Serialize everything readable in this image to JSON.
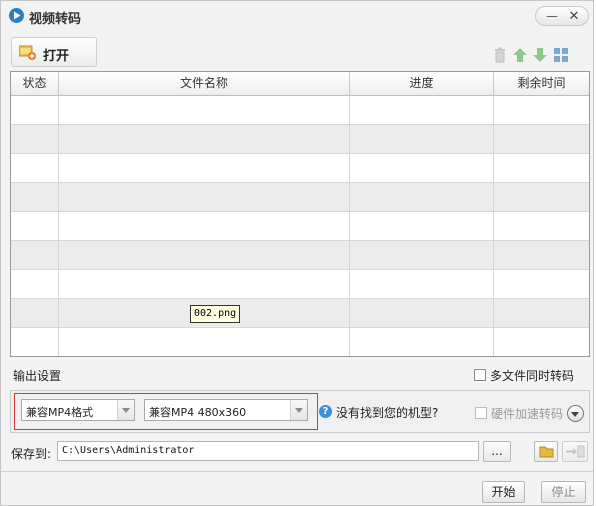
{
  "window": {
    "title": "视频转码",
    "minimize_symbol": "—",
    "close_symbol": "✕"
  },
  "toolbar": {
    "open_label": "打开",
    "icons": [
      "trash-icon",
      "move-up-icon",
      "move-down-icon",
      "grid-view-icon"
    ]
  },
  "file_table": {
    "columns": [
      "状态",
      "文件名称",
      "进度",
      "剩余时间"
    ],
    "rows": [],
    "tooltip": "002.png"
  },
  "output_settings": {
    "label": "输出设置",
    "multi_file_label": "多文件同时转码",
    "multi_file_checked": false,
    "format_select": "兼容MP4格式",
    "profile_select": "兼容MP4 480x360",
    "help_text": "没有找到您的机型?",
    "hw_accel_label": "硬件加速转码",
    "hw_accel_checked": false
  },
  "save": {
    "label": "保存到:",
    "path": "C:\\Users\\Administrator",
    "browse_label": "..."
  },
  "actions": {
    "start_label": "开始",
    "stop_label": "停止"
  },
  "colors": {
    "highlight_border": "#d9383a",
    "up_arrow": "#7fc07a",
    "accent_blue": "#2d7fc3"
  }
}
